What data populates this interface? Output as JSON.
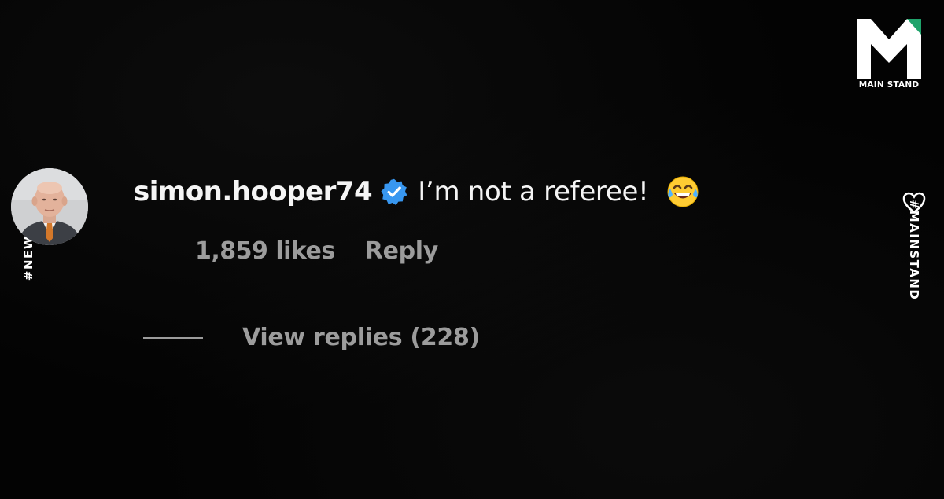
{
  "brand": {
    "name": "MAIN STAND",
    "logo_icon": "main-stand-m-logo",
    "accent_color": "#1fa36b"
  },
  "tags": {
    "left": "#NEWS",
    "right": "#MAINSTAND"
  },
  "comment": {
    "avatar_icon": "user-avatar-photo",
    "username": "simon.hooper74",
    "verified_icon": "verified-badge-icon",
    "verified_color": "#3897f0",
    "text": "I’m not a referee!",
    "emoji_icon": "face-with-tears-of-joy-icon",
    "likes": "1,859 likes",
    "reply_label": "Reply",
    "view_replies_label": "View replies (228)"
  }
}
